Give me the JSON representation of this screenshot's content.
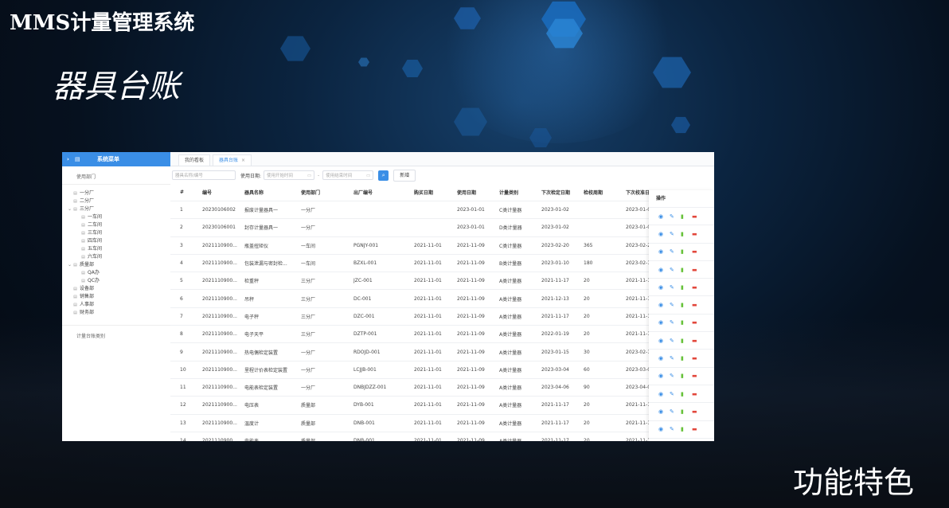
{
  "slide": {
    "title": "MMS计量管理系统",
    "subtitle": "器具台账",
    "feature": "功能特色"
  },
  "sidebar": {
    "menu_icon": "menu-icon",
    "header": "系统菜单",
    "section_dept": "使用部门",
    "tree": [
      {
        "label": "一分厂",
        "level": 0,
        "toggle": ""
      },
      {
        "label": "二分厂",
        "level": 0,
        "toggle": ""
      },
      {
        "label": "三分厂",
        "level": 0,
        "toggle": "v"
      },
      {
        "label": "一车间",
        "level": 1,
        "toggle": ""
      },
      {
        "label": "二车间",
        "level": 1,
        "toggle": ""
      },
      {
        "label": "三车间",
        "level": 1,
        "toggle": ""
      },
      {
        "label": "四车间",
        "level": 1,
        "toggle": ""
      },
      {
        "label": "五车间",
        "level": 1,
        "toggle": ""
      },
      {
        "label": "六车间",
        "level": 1,
        "toggle": ""
      },
      {
        "label": "质量部",
        "level": 0,
        "toggle": "v"
      },
      {
        "label": "QA办",
        "level": 1,
        "toggle": ""
      },
      {
        "label": "QC办",
        "level": 1,
        "toggle": ""
      },
      {
        "label": "设备部",
        "level": 0,
        "toggle": ""
      },
      {
        "label": "销售部",
        "level": 0,
        "toggle": ""
      },
      {
        "label": "人事部",
        "level": 0,
        "toggle": ""
      },
      {
        "label": "财务部",
        "level": 0,
        "toggle": ""
      }
    ],
    "section_category": "计量台账类别"
  },
  "tabs": [
    {
      "label": "我的看板",
      "active": false,
      "closable": false
    },
    {
      "label": "器具台账",
      "active": true,
      "closable": true
    }
  ],
  "filters": {
    "name_placeholder": "器具名称/编号",
    "date_label": "使用日期:",
    "start_placeholder": "使用开始时间",
    "end_placeholder": "使用结束时间",
    "separator": "-",
    "add_label": "新增"
  },
  "table": {
    "columns": [
      "#",
      "编号",
      "器具名称",
      "使用部门",
      "出厂编号",
      "购买日期",
      "使用日期",
      "计量类别",
      "下次检定日期",
      "检校周期",
      "下次校准日"
    ],
    "ops_header": "操作",
    "rows": [
      [
        "1",
        "20230106002",
        "报废计量器具一",
        "一分厂",
        "",
        "",
        "2023-01-01",
        "C类计量器",
        "2023-01-02",
        "",
        "2023-01-02"
      ],
      [
        "2",
        "20230106001",
        "封存计量器具一",
        "一分厂",
        "",
        "",
        "2023-01-01",
        "D类计量器",
        "2023-01-02",
        "",
        "2023-01-02"
      ],
      [
        "3",
        "2021110900...",
        "瓶盖扭矩仪",
        "一车间",
        "PGNJY-001",
        "2021-11-01",
        "2021-11-09",
        "C类计量器",
        "2023-02-20",
        "365",
        "2023-02-20"
      ],
      [
        "4",
        "2021110900...",
        "包装泄漏与密封检...",
        "一车间",
        "BZXL-001",
        "2021-11-01",
        "2021-11-09",
        "B类计量器",
        "2023-01-10",
        "180",
        "2023-02-10"
      ],
      [
        "5",
        "2021110900...",
        "检重秤",
        "三分厂",
        "JZC-001",
        "2021-11-01",
        "2021-11-09",
        "A类计量器",
        "2021-11-17",
        "20",
        "2021-11-17"
      ],
      [
        "6",
        "2021110900...",
        "吊秤",
        "三分厂",
        "DC-001",
        "2021-11-01",
        "2021-11-09",
        "A类计量器",
        "2021-12-13",
        "20",
        "2021-11-17"
      ],
      [
        "7",
        "2021110900...",
        "电子秤",
        "三分厂",
        "DZC-001",
        "2021-11-01",
        "2021-11-09",
        "A类计量器",
        "2021-11-17",
        "20",
        "2021-11-17"
      ],
      [
        "8",
        "2021110900...",
        "电子天平",
        "三分厂",
        "DZTP-001",
        "2021-11-01",
        "2021-11-09",
        "A类计量器",
        "2022-01-19",
        "20",
        "2021-11-17"
      ],
      [
        "9",
        "2021110900...",
        "热电偶检定装置",
        "一分厂",
        "RDOJD-001",
        "2021-11-01",
        "2021-11-09",
        "A类计量器",
        "2023-01-15",
        "30",
        "2023-02-15"
      ],
      [
        "10",
        "2021110900...",
        "里程计价表检定装置",
        "一分厂",
        "LCJJB-001",
        "2021-11-01",
        "2021-11-09",
        "A类计量器",
        "2023-03-04",
        "60",
        "2023-03-04"
      ],
      [
        "11",
        "2021110900...",
        "电能表检定装置",
        "一分厂",
        "DNBJDZZ-001",
        "2021-11-01",
        "2021-11-09",
        "A类计量器",
        "2023-04-06",
        "90",
        "2023-04-06"
      ],
      [
        "12",
        "2021110900...",
        "电压表",
        "质量部",
        "DYB-001",
        "2021-11-01",
        "2021-11-09",
        "A类计量器",
        "2021-11-17",
        "20",
        "2021-11-17"
      ],
      [
        "13",
        "2021110900...",
        "温度计",
        "质量部",
        "DNB-001",
        "2021-11-01",
        "2021-11-09",
        "A类计量器",
        "2021-11-17",
        "20",
        "2021-11-17"
      ],
      [
        "14",
        "2021110900...",
        "电能表",
        "质量部",
        "DNB-001",
        "2021-11-01",
        "2021-11-09",
        "A类计量器",
        "2021-11-17",
        "20",
        "2021-11-17"
      ]
    ],
    "row_actions": [
      {
        "icon": "view-icon",
        "glyph": "◉",
        "color": "#3a8ee6"
      },
      {
        "icon": "edit-icon",
        "glyph": "✎",
        "color": "#3a8ee6"
      },
      {
        "icon": "clipboard-icon",
        "glyph": "▮",
        "color": "#67c23a"
      },
      {
        "icon": "delete-icon",
        "glyph": "▬",
        "color": "#e2473b"
      }
    ]
  }
}
